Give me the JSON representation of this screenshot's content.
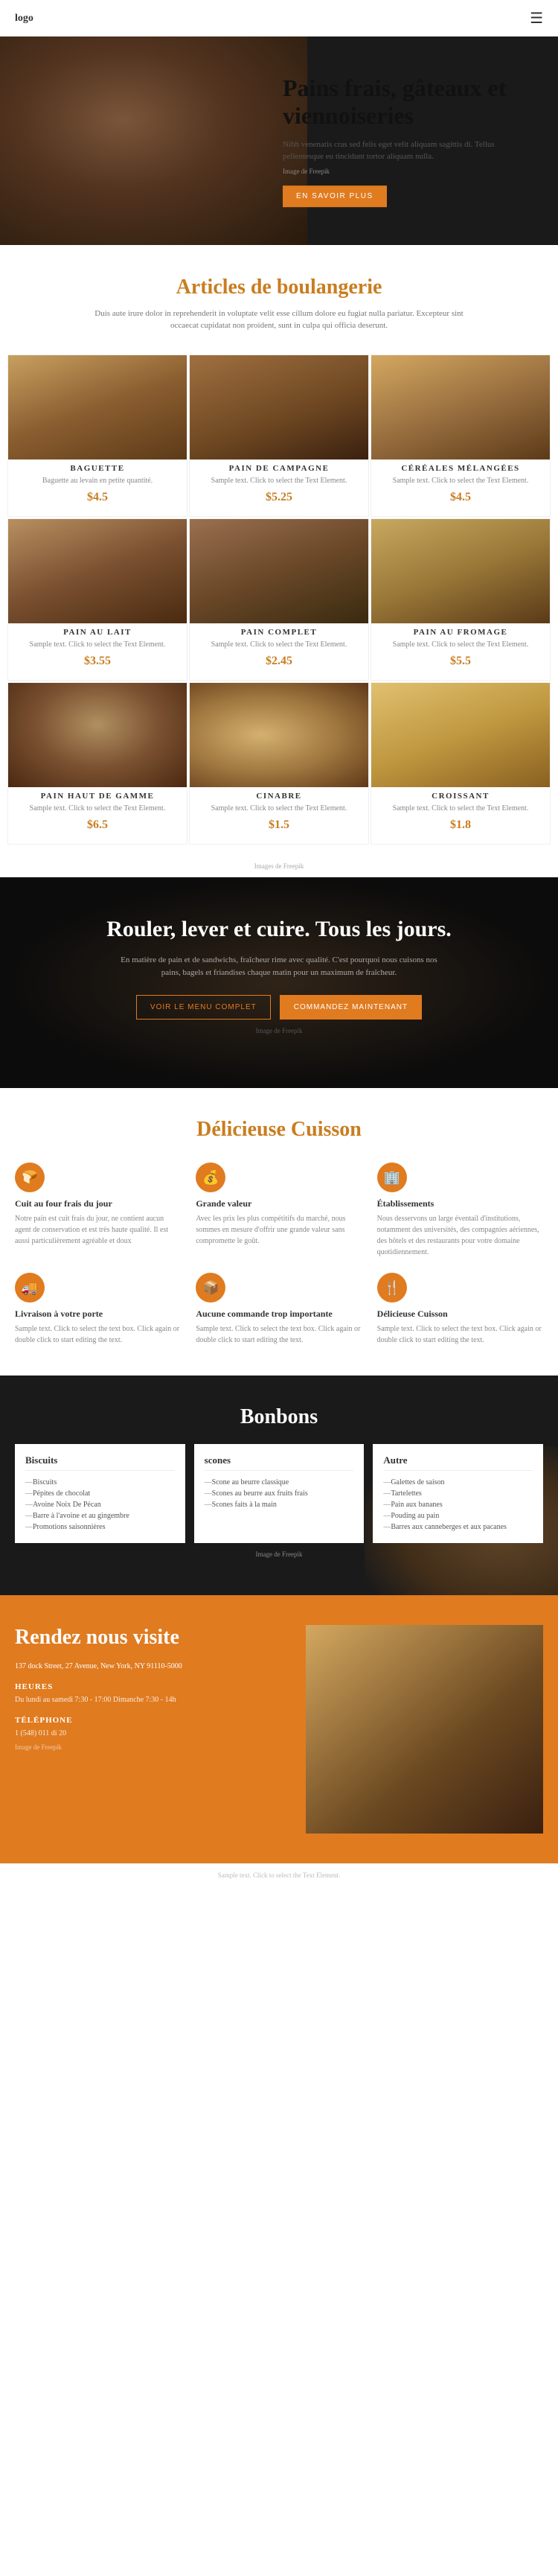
{
  "header": {
    "logo": "logo",
    "hamburger_icon": "☰"
  },
  "hero": {
    "title": "Pains frais, gâteaux et viennoiseries",
    "subtitle": "Nibh venenatis cras sed felis eget velit aliquam sagittis di. Tellus pellentesque eu tincidunt tortor aliquam nulla.",
    "image_credit": "Image de Freepik",
    "btn_label": "EN SAVOIR PLUS"
  },
  "bakery_section": {
    "title": "Articles de boulangerie",
    "subtitle": "Duis aute irure dolor in reprehenderit in voluptate velit esse cillum dolore eu fugiat nulla pariatur. Excepteur sint occaecat cupidatat non proident, sunt in culpa qui officia deserunt.",
    "image_credit": "Images de Freepik",
    "items": [
      {
        "name": "BAGUETTE",
        "desc": "Baguette au levain en petite quantité.",
        "price": "$4.5",
        "img_class": "bread-img-baguette"
      },
      {
        "name": "PAIN DE CAMPAGNE",
        "desc": "Sample text. Click to select the Text Element.",
        "price": "$5.25",
        "img_class": "bread-img-campagne"
      },
      {
        "name": "CÉRÉALES MÉLANGÉES",
        "desc": "Sample text. Click to select the Text Element.",
        "price": "$4.5",
        "img_class": "bread-img-cereales"
      },
      {
        "name": "PAIN AU LAIT",
        "desc": "Sample text. Click to select the Text Element.",
        "price": "$3.55",
        "img_class": "bread-img-lait"
      },
      {
        "name": "PAIN COMPLET",
        "desc": "Sample text. Click to select the Text Element.",
        "price": "$2.45",
        "img_class": "bread-img-complet"
      },
      {
        "name": "PAIN AU FROMAGE",
        "desc": "Sample text. Click to select the Text Element.",
        "price": "$5.5",
        "img_class": "bread-img-fromage"
      },
      {
        "name": "PAIN HAUT DE GAMME",
        "desc": "Sample text. Click to select the Text Element.",
        "price": "$6.5",
        "img_class": "bread-img-hautgamme"
      },
      {
        "name": "CINABRE",
        "desc": "Sample text. Click to select the Text Element.",
        "price": "$1.5",
        "img_class": "bread-img-cinabre"
      },
      {
        "name": "CROISSANT",
        "desc": "Sample text. Click to select the Text Element.",
        "price": "$1.8",
        "img_class": "bread-img-croissant"
      }
    ]
  },
  "dark_section": {
    "title": "Rouler, lever et cuire. Tous les jours.",
    "text": "En matière de pain et de sandwichs, fraîcheur rime avec qualité. C'est pourquoi nous cuisons nos pains, bagels et friandises chaque matin pour un maximum de fraîcheur.",
    "image_credit": "Image de Freepik",
    "btn_menu": "VOIR LE MENU COMPLET",
    "btn_order": "COMMANDEZ MAINTENANT"
  },
  "delicious_section": {
    "title": "Délicieuse Cuisson",
    "items": [
      {
        "icon": "🍞",
        "title": "Cuit au four frais du jour",
        "text": "Notre pain est cuit frais du jour, ne contient aucun agent de conservation et est très haute qualité. Il est aussi particulièrement agréable et doux",
        "icon_name": "bread-icon"
      },
      {
        "icon": "💰",
        "title": "Grande valeur",
        "text": "Avec les prix les plus compétitifs du marché, nous sommes en mesure d'offrir une grande valeur sans compromette le goût.",
        "icon_name": "value-icon"
      },
      {
        "icon": "🏢",
        "title": "Établissements",
        "text": "Nous desservons un large éventail d'institutions, notamment des universités, des compagnies aériennes, des hôtels et des restaurants pour votre domaine quotidiennement.",
        "icon_name": "building-icon"
      },
      {
        "icon": "🚚",
        "title": "Livraison à votre porte",
        "text": "Sample text. Click to select the text box. Click again or double click to start editing the text.",
        "icon_name": "delivery-icon"
      },
      {
        "icon": "📦",
        "title": "Aucune commande trop importante",
        "text": "Sample text. Click to select the text box. Click again or double click to start editing the text.",
        "icon_name": "package-icon"
      },
      {
        "icon": "🍴",
        "title": "Délicieuse Cuisson",
        "text": "Sample text. Click to select the text box. Click again or double click to start editing the text.",
        "icon_name": "fork-icon"
      }
    ]
  },
  "bonbons_section": {
    "title": "Bonbons",
    "image_credit": "Image de Freepik",
    "columns": [
      {
        "title": "Biscuits",
        "items": [
          "Biscuits",
          "Pépites de chocolat",
          "Avoine Noix De Pécan",
          "Barre à l'avoine et au gingembre",
          "Promotions saisonnières"
        ]
      },
      {
        "title": "scones",
        "items": [
          "Scone au beurre classique",
          "Scones au beurre aux fruits frais",
          "Scones faits à la main"
        ]
      },
      {
        "title": "Autre",
        "items": [
          "Galettes de saison",
          "Tartelettes",
          "Pain aux bananes",
          "Pouding au pain",
          "Barres aux canneberges et aux pacanes"
        ]
      }
    ]
  },
  "visit_section": {
    "title": "Rendez nous visite",
    "address": "137 dock Street, 27 Avenue,\nNew York, NY 91110-5000",
    "hours_label": "HEURES",
    "hours_text": "Du lundi au samedi\n7:30 - 17:00\n\nDimanche\n7:30 - 14h",
    "phone_label": "TÉLÉPHONE",
    "phone_text": "1 (548) 011 di 20",
    "image_credit": "Image de Freepik"
  },
  "footer": {
    "text": "Sample text. Click to select the Text Element."
  }
}
